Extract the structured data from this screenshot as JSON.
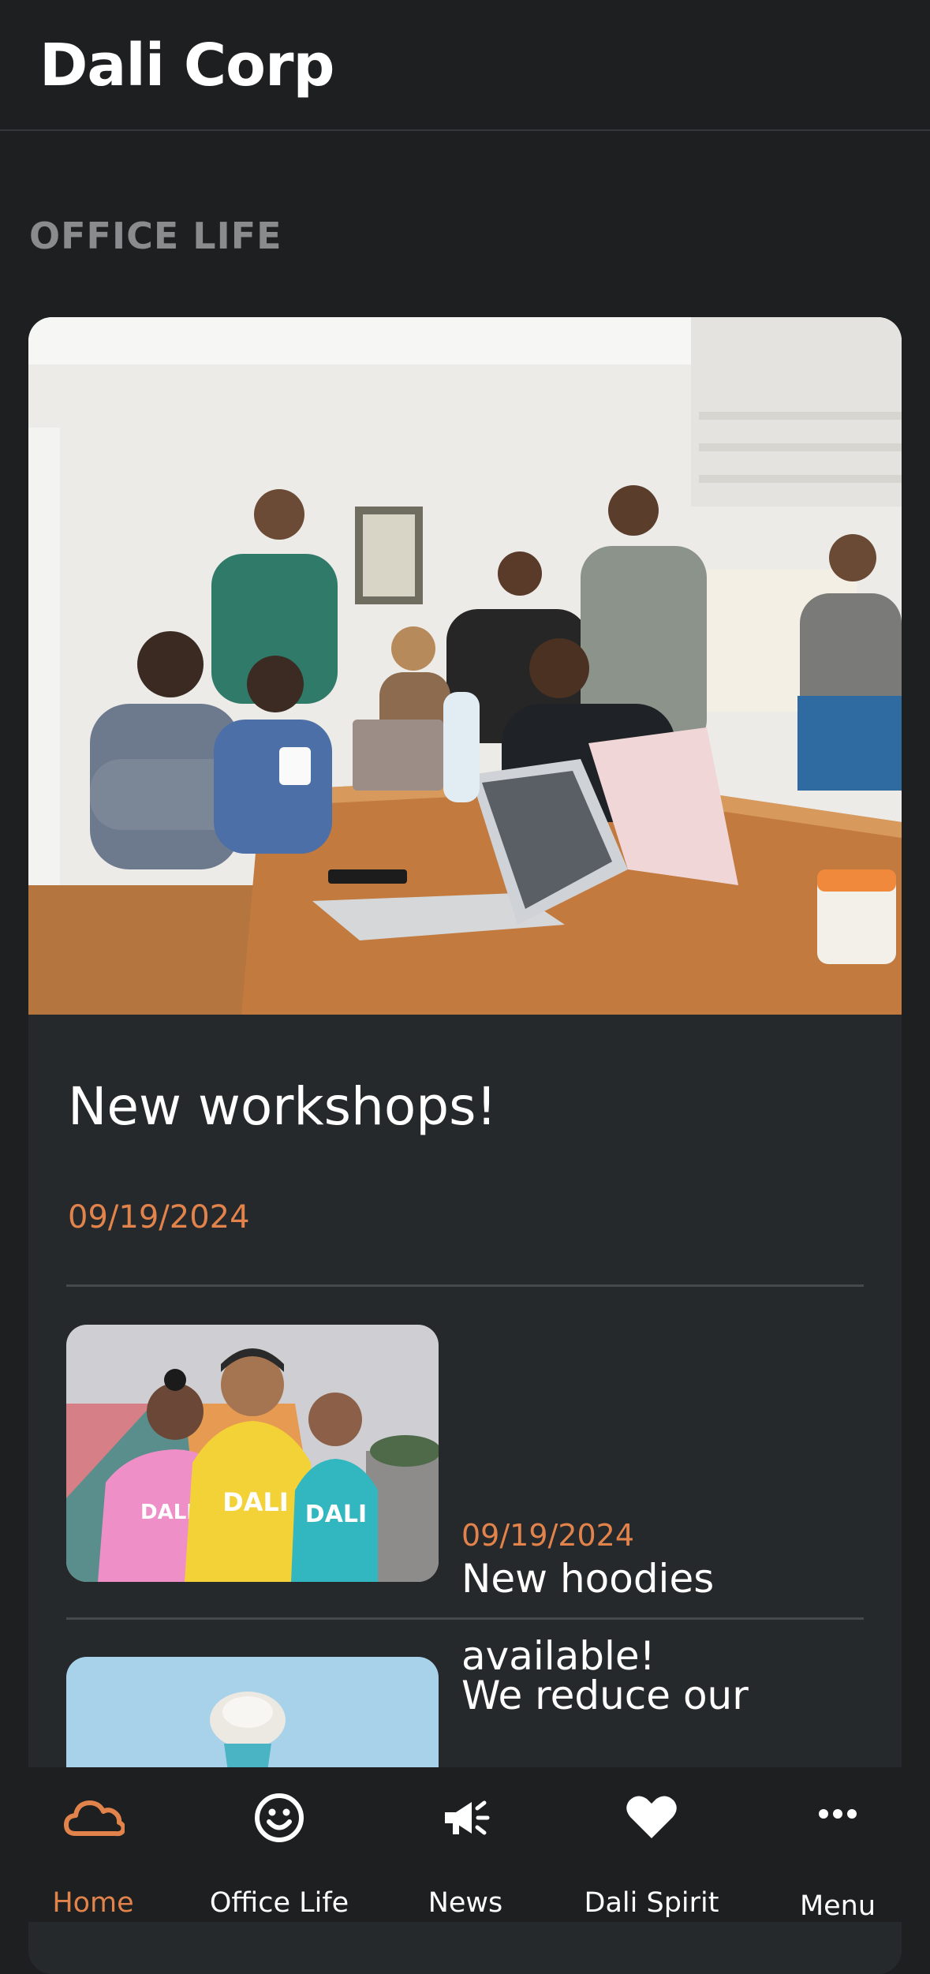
{
  "header": {
    "title": "Dali Corp"
  },
  "section": {
    "title": "OFFICE LIFE"
  },
  "hero": {
    "title": "New workshops!",
    "date": "09/19/2024"
  },
  "items": [
    {
      "title": "New hoodies available!",
      "date": "09/19/2024",
      "hoodie_text": "DALI"
    },
    {
      "title": "We reduce our"
    }
  ],
  "nav": {
    "active_color": "#e2834b",
    "items": [
      {
        "label": "Home",
        "icon": "cloud-icon",
        "active": true
      },
      {
        "label": "Office Life",
        "icon": "smiley-icon",
        "active": false
      },
      {
        "label": "News",
        "icon": "megaphone-icon",
        "active": false
      },
      {
        "label": "Dali Spirit",
        "icon": "heart-icon",
        "active": false
      },
      {
        "label": "Menu",
        "icon": "more-icon",
        "active": false
      }
    ]
  }
}
